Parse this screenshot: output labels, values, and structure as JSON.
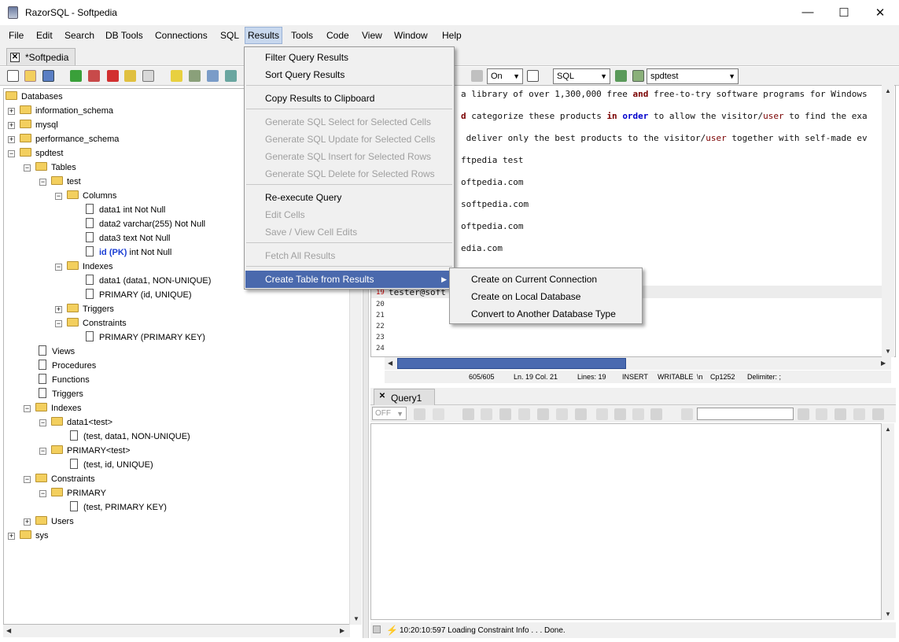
{
  "window": {
    "title": "RazorSQL - Softpedia",
    "minimize": "—",
    "maximize": "☐",
    "close": "✕"
  },
  "menubar": [
    "File",
    "Edit",
    "Search",
    "DB Tools",
    "Connections",
    "SQL",
    "Results",
    "Tools",
    "Code",
    "View",
    "Window",
    "Help"
  ],
  "doc_tab": {
    "label": "*Softpedia"
  },
  "toolbar": {
    "on_combo": "On",
    "lang_combo": "SQL",
    "db_combo": "spdtest"
  },
  "tree": {
    "root": "Databases",
    "information_schema": "information_schema",
    "mysql": "mysql",
    "performance_schema": "performance_schema",
    "spdtest": "spdtest",
    "tables": "Tables",
    "test": "test",
    "columns": "Columns",
    "col1": "data1 int Not Null",
    "col2": "data2 varchar(255) Not Null",
    "col3": "data3 text Not Null",
    "col4_pk": "id (PK)",
    "col4_rest": " int Not Null",
    "indexes": "Indexes",
    "idx1": "data1 (data1, NON-UNIQUE)",
    "idx2": "PRIMARY (id, UNIQUE)",
    "triggers": "Triggers",
    "constraints": "Constraints",
    "con1": "PRIMARY (PRIMARY KEY)",
    "views": "Views",
    "procedures": "Procedures",
    "functions": "Functions",
    "triggers2": "Triggers",
    "indexes2": "Indexes",
    "data1_test": "data1<test>",
    "data1_test_detail": "(test, data1, NON-UNIQUE)",
    "primary_test": "PRIMARY<test>",
    "primary_test_detail": "(test, id, UNIQUE)",
    "constraints2": "Constraints",
    "primary2": "PRIMARY",
    "primary2_detail": "(test, PRIMARY KEY)",
    "users": "Users",
    "sys": "sys"
  },
  "editor": {
    "line1_a": "a library of over 1,300,000 free ",
    "line1_kw": "and",
    "line1_b": " free-to-try software programs for Windows",
    "line2_kw": "d",
    "line2_a": " categorize these products ",
    "line2_kw2": "in",
    "line2_sp": " ",
    "line2_kw3": "order",
    "line2_b": " to allow the visitor/",
    "line2_user": "user",
    "line2_c": " to find the exa",
    "line3_a": " deliver only the best products to the visitor/",
    "line3_user": "user",
    "line3_b": " together with self-made ev",
    "line4": "ftpedia test",
    "line5": "oftpedia.com",
    "line6": "softpedia.com",
    "line7": "oftpedia.com",
    "line8": "edia.com",
    "line19": "tester@soft",
    "ln19": "19",
    "ln20": "20",
    "ln21": "21",
    "ln22": "22",
    "ln23": "23",
    "ln24": "24"
  },
  "status": {
    "chars": "605/605",
    "pos": "Ln. 19 Col. 21",
    "lines": "Lines: 19",
    "mode": "INSERT",
    "writable": "WRITABLE",
    "newline": "\\n",
    "encoding": "Cp1252",
    "delimiter": "Delimiter: ;"
  },
  "query_tab": {
    "label": "Query1"
  },
  "results_toolbar": {
    "off_combo": "OFF"
  },
  "bottom_status": {
    "message": "10:20:10:597 Loading Constraint Info . . . Done."
  },
  "results_menu": {
    "filter": "Filter Query Results",
    "sort": "Sort Query Results",
    "copy": "Copy Results to Clipboard",
    "gen_select": "Generate SQL Select for Selected Cells",
    "gen_update": "Generate SQL Update for Selected Cells",
    "gen_insert": "Generate SQL Insert for Selected Rows",
    "gen_delete": "Generate SQL Delete for Selected Rows",
    "reexecute": "Re-execute Query",
    "edit_cells": "Edit Cells",
    "save_edits": "Save / View Cell Edits",
    "fetch_all": "Fetch All Results",
    "create_table": "Create Table from Results",
    "arrow": "▶"
  },
  "submenu": {
    "current": "Create on Current Connection",
    "local": "Create on Local Database",
    "convert": "Convert to Another Database Type"
  }
}
